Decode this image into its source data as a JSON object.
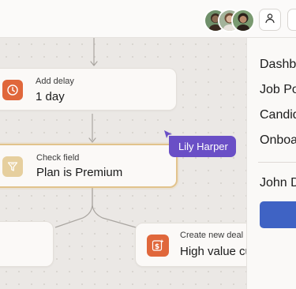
{
  "topbar": {
    "avatars": [
      {
        "name": "avatar-1",
        "skin": "#8a6a52",
        "hair": "#3a2a20",
        "bg": "#6f8f6a"
      },
      {
        "name": "avatar-2",
        "skin": "#d9b49a",
        "hair": "#6b4a35",
        "bg": "#a3b39a"
      },
      {
        "name": "avatar-3",
        "skin": "#b88a6c",
        "hair": "#2b211a",
        "bg": "#7a9a70"
      }
    ],
    "user_icon": "user-icon"
  },
  "workflow": {
    "nodes": [
      {
        "label": "Add delay",
        "value": "1 day",
        "icon": "clock-icon",
        "icon_color": "#e0673b"
      },
      {
        "label": "Check field",
        "value": "Plan is Premium",
        "icon": "filter-icon",
        "icon_color": "#e6cf9e"
      },
      {
        "label": "",
        "value": "",
        "icon": ""
      },
      {
        "label": "Create new deal",
        "value": "High value customer",
        "icon": "dollar-icon",
        "icon_color": "#e0673b"
      }
    ],
    "collaborator_cursor": {
      "name": "Lily Harper",
      "color": "#6a4fc6"
    }
  },
  "sidepanel": {
    "nav": [
      "Dashboard",
      "Job Postings",
      "Candidates",
      "Onboarding"
    ],
    "user": "John Doe",
    "primary_color": "#3f63c4"
  }
}
